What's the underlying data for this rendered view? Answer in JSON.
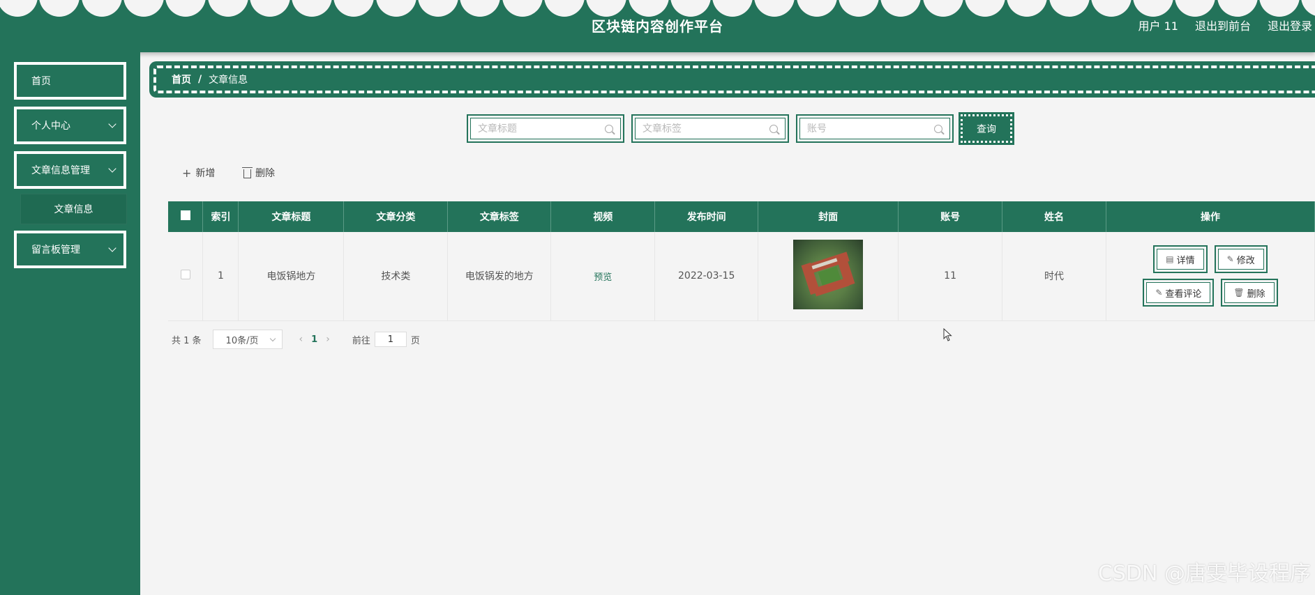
{
  "header": {
    "title": "区块链内容创作平台",
    "user_label": "用户 11",
    "to_front_label": "退出到前台",
    "logout_label": "退出登录"
  },
  "sidebar": {
    "items": [
      {
        "label": "首页",
        "has_arrow": false
      },
      {
        "label": "个人中心",
        "has_arrow": true
      },
      {
        "label": "文章信息管理",
        "has_arrow": true
      },
      {
        "label": "留言板管理",
        "has_arrow": true
      }
    ],
    "active_sub": "文章信息"
  },
  "breadcrumb": {
    "home": "首页",
    "separator": "/",
    "current": "文章信息"
  },
  "search": {
    "title_placeholder": "文章标题",
    "tag_placeholder": "文章标签",
    "account_placeholder": "账号",
    "query_label": "查询"
  },
  "toolbar": {
    "add_label": "新增",
    "delete_label": "删除"
  },
  "table": {
    "columns": [
      "索引",
      "文章标题",
      "文章分类",
      "文章标签",
      "视频",
      "发布时间",
      "封面",
      "账号",
      "姓名",
      "操作"
    ],
    "rows": [
      {
        "index": "1",
        "title": "电饭锅地方",
        "category": "技术类",
        "tag": "电饭锅发的地方",
        "video": "预览",
        "date": "2022-03-15",
        "account": "11",
        "name": "时代",
        "actions": {
          "detail": "详情",
          "edit": "修改",
          "comments": "查看评论",
          "delete": "删除"
        }
      }
    ]
  },
  "pagination": {
    "total": "共 1 条",
    "page_size": "10条/页",
    "current_page": "1",
    "goto_label": "前往",
    "goto_value": "1",
    "page_suffix": "页"
  },
  "watermark": "CSDN @唐雯毕设程序",
  "colors": {
    "primary": "#23735a",
    "background": "#f4f4f4"
  }
}
